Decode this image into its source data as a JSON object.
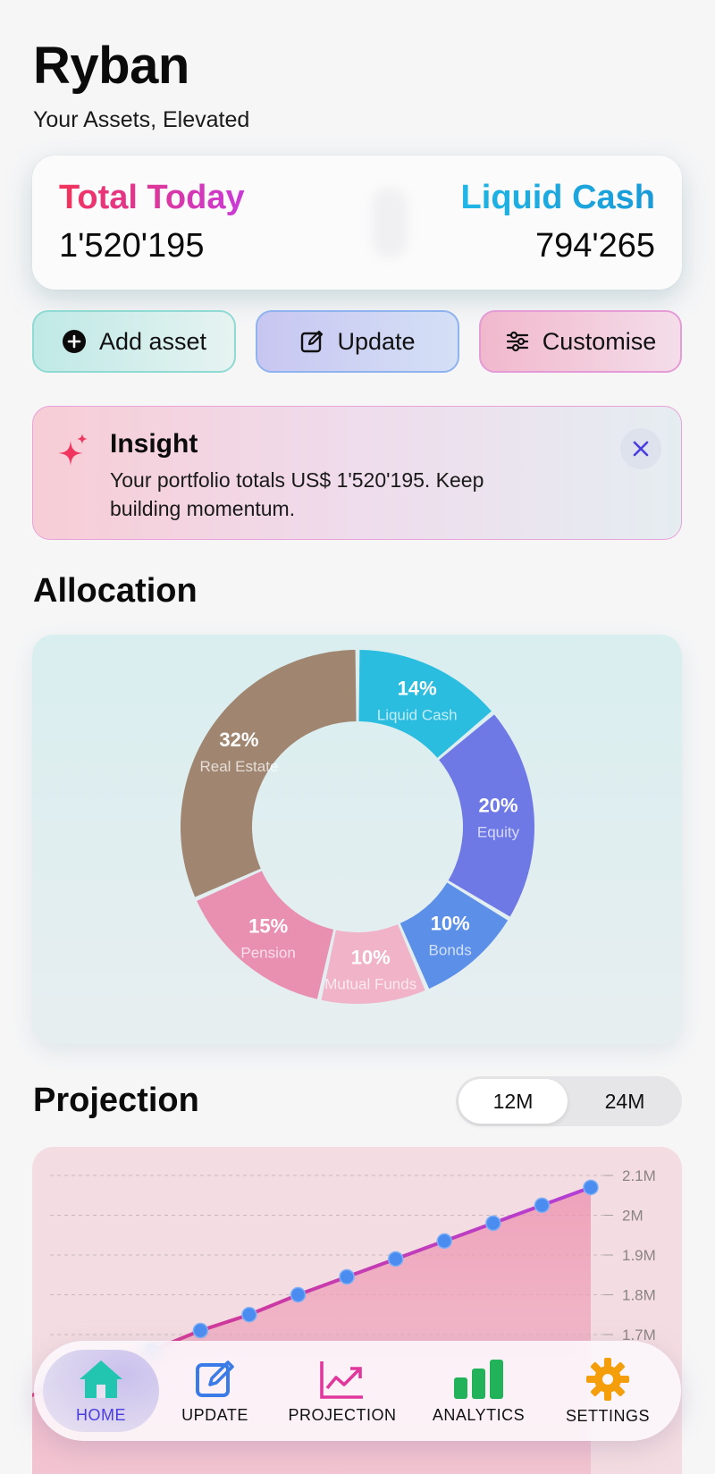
{
  "header": {
    "title": "Ryban",
    "subtitle": "Your Assets, Elevated"
  },
  "summary": {
    "left_label": "Total Today",
    "left_value": "1'520'195",
    "right_label": "Liquid Cash",
    "right_value": "794'265"
  },
  "actions": {
    "add": "Add asset",
    "update": "Update",
    "customise": "Customise"
  },
  "insight": {
    "title": "Insight",
    "text": "Your portfolio totals US$ 1'520'195. Keep building momentum."
  },
  "allocation": {
    "title": "Allocation",
    "chart_data": {
      "type": "pie",
      "slices": [
        {
          "label": "Liquid Cash",
          "pct": "14%",
          "value": 14,
          "color": "#2bbde0"
        },
        {
          "label": "Equity",
          "pct": "20%",
          "value": 20,
          "color": "#6f79e6"
        },
        {
          "label": "Bonds",
          "pct": "10%",
          "value": 10,
          "color": "#5b8fe8"
        },
        {
          "label": "Mutual Funds",
          "pct": "10%",
          "value": 10,
          "color": "#f0b3c8"
        },
        {
          "label": "Pension",
          "pct": "15%",
          "value": 15,
          "color": "#e98fb0"
        },
        {
          "label": "Real Estate",
          "pct": "32%",
          "value": 32,
          "color": "#a08570"
        }
      ]
    }
  },
  "projection": {
    "title": "Projection",
    "range_options": [
      "12M",
      "24M"
    ],
    "chart_data": {
      "type": "area",
      "y_ticks": [
        "2.1M",
        "2M",
        "1.9M",
        "1.8M",
        "1.7M"
      ],
      "ylim": [
        1.52,
        2.1
      ],
      "values": [
        1.52,
        1.57,
        1.62,
        1.66,
        1.71,
        1.75,
        1.8,
        1.845,
        1.89,
        1.935,
        1.98,
        2.025,
        2.07
      ]
    }
  },
  "tabs": [
    {
      "label": "HOME",
      "icon": "home-icon",
      "color": "#22c6b0"
    },
    {
      "label": "UPDATE",
      "icon": "edit-icon",
      "color": "#3b7be8"
    },
    {
      "label": "PROJECTION",
      "icon": "trend-icon",
      "color": "#e0379d"
    },
    {
      "label": "ANALYTICS",
      "icon": "bar-chart-icon",
      "color": "#22b35a"
    },
    {
      "label": "SETTINGS",
      "icon": "gear-icon",
      "color": "#f59e0b"
    }
  ]
}
